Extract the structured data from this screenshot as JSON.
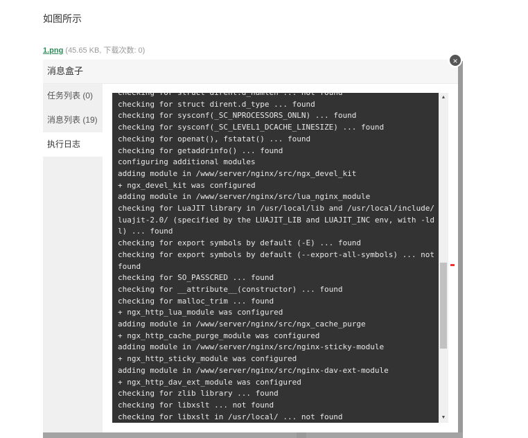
{
  "caption": "如图所示",
  "attachment": {
    "filename": "1.png",
    "meta": "(45.65 KB, 下载次数: 0)"
  },
  "modal": {
    "title": "消息盒子",
    "close_icon": "×",
    "tabs": [
      {
        "label": "任务列表 (0)",
        "active": false
      },
      {
        "label": "消息列表 (19)",
        "active": false
      },
      {
        "label": "执行日志",
        "active": true
      }
    ],
    "log_lines": [
      "checking for struct dirent.d_namlen ... not found",
      "checking for struct dirent.d_type ... found",
      "checking for sysconf(_SC_NPROCESSORS_ONLN) ... found",
      "checking for sysconf(_SC_LEVEL1_DCACHE_LINESIZE) ... found",
      "checking for openat(), fstatat() ... found",
      "checking for getaddrinfo() ... found",
      "configuring additional modules",
      "adding module in /www/server/nginx/src/ngx_devel_kit",
      "+ ngx_devel_kit was configured",
      "adding module in /www/server/nginx/src/lua_nginx_module",
      "checking for LuaJIT library in /usr/local/lib and /usr/local/include/luajit-2.0/ (specified by the LUAJIT_LIB and LUAJIT_INC env, with -ldl) ... found",
      "checking for export symbols by default (-E) ... found",
      "checking for export symbols by default (--export-all-symbols) ... not found",
      "checking for SO_PASSCRED ... found",
      "checking for __attribute__(constructor) ... found",
      "checking for malloc_trim ... found",
      "+ ngx_http_lua_module was configured",
      "adding module in /www/server/nginx/src/ngx_cache_purge",
      "+ ngx_http_cache_purge_module was configured",
      "adding module in /www/server/nginx/src/nginx-sticky-module",
      "+ ngx_http_sticky_module was configured",
      "adding module in /www/server/nginx/src/nginx-dav-ext-module",
      "+ ngx_http_dav_ext_module was configured",
      "checking for zlib library ... found",
      "checking for libxslt ... not found",
      "checking for libxslt in /usr/local/ ... not found"
    ],
    "scroll_up_icon": "▲",
    "scroll_down_icon": "▼",
    "scroll_position": 0.65
  }
}
